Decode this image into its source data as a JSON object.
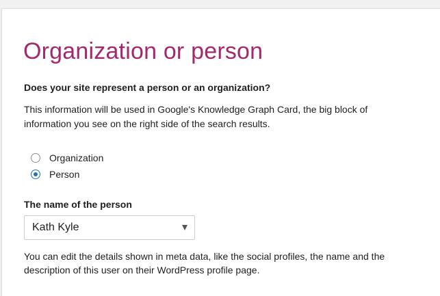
{
  "section": {
    "title": "Organization or person",
    "question": "Does your site represent a person or an organization?",
    "description": "This information will be used in Google's Knowledge Graph Card, the big block of information you see on the right side of the search results."
  },
  "options": [
    {
      "label": "Organization",
      "checked": false
    },
    {
      "label": "Person",
      "checked": true
    }
  ],
  "person_field": {
    "label": "The name of the person",
    "selected_value": "Kath Kyle",
    "icon": "chevron-down-icon"
  },
  "help_text": "You can edit the details shown in meta data, like the social profiles, the name and the description of this user on their WordPress profile page.",
  "colors": {
    "title": "#a4286a",
    "radio_accent": "#2271b1",
    "background": "#f1f1f1",
    "panel": "#ffffff"
  }
}
